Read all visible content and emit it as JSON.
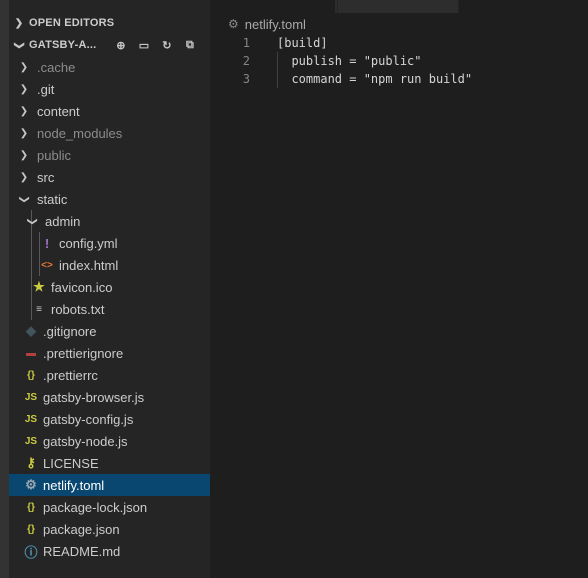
{
  "explorer": {
    "open_editors_label": "OPEN EDITORS",
    "root_label": "GATSBY-A...",
    "actions": [
      {
        "name": "new-file-icon",
        "glyph": "⊕"
      },
      {
        "name": "new-folder-icon",
        "glyph": "▭"
      },
      {
        "name": "refresh-icon",
        "glyph": "↻"
      },
      {
        "name": "collapse-all-icon",
        "glyph": "⧉"
      }
    ],
    "items": [
      {
        "label": ".cache",
        "kind": "folder",
        "depth": 1,
        "open": false,
        "dim": true
      },
      {
        "label": ".git",
        "kind": "folder",
        "depth": 1,
        "open": false,
        "dim": false
      },
      {
        "label": "content",
        "kind": "folder",
        "depth": 1,
        "open": false,
        "dim": false
      },
      {
        "label": "node_modules",
        "kind": "folder",
        "depth": 1,
        "open": false,
        "dim": true
      },
      {
        "label": "public",
        "kind": "folder",
        "depth": 1,
        "open": false,
        "dim": true
      },
      {
        "label": "src",
        "kind": "folder",
        "depth": 1,
        "open": false,
        "dim": false
      },
      {
        "label": "static",
        "kind": "folder",
        "depth": 1,
        "open": true,
        "dim": false
      },
      {
        "label": "admin",
        "kind": "folder",
        "depth": 2,
        "open": true,
        "dim": false
      },
      {
        "label": "config.yml",
        "kind": "file",
        "depth": 3,
        "icon": "yaml-icon",
        "glyph": "!",
        "color": "#a074c4"
      },
      {
        "label": "index.html",
        "kind": "file",
        "depth": 3,
        "icon": "html-icon",
        "glyph": "<>",
        "color": "#e37933"
      },
      {
        "label": "favicon.ico",
        "kind": "file",
        "depth": 2,
        "icon": "star-icon",
        "glyph": "★",
        "color": "#cbcb41"
      },
      {
        "label": "robots.txt",
        "kind": "file",
        "depth": 2,
        "icon": "text-file-icon",
        "glyph": "≡",
        "color": "#c5c5c5"
      },
      {
        "label": ".gitignore",
        "kind": "file",
        "depth": 1,
        "icon": "git-icon",
        "glyph": "◆",
        "color": "#41535b"
      },
      {
        "label": ".prettierignore",
        "kind": "file",
        "depth": 1,
        "icon": "prettier-ignore-icon",
        "glyph": "▬",
        "color": "#b0413e"
      },
      {
        "label": ".prettierrc",
        "kind": "file",
        "depth": 1,
        "icon": "json-icon",
        "glyph": "{}",
        "color": "#cbcb41"
      },
      {
        "label": "gatsby-browser.js",
        "kind": "file",
        "depth": 1,
        "icon": "js-icon",
        "glyph": "JS",
        "color": "#cbcb41"
      },
      {
        "label": "gatsby-config.js",
        "kind": "file",
        "depth": 1,
        "icon": "js-icon",
        "glyph": "JS",
        "color": "#cbcb41"
      },
      {
        "label": "gatsby-node.js",
        "kind": "file",
        "depth": 1,
        "icon": "js-icon",
        "glyph": "JS",
        "color": "#cbcb41"
      },
      {
        "label": "LICENSE",
        "kind": "file",
        "depth": 1,
        "icon": "license-icon",
        "glyph": "⚷",
        "color": "#cbcb41"
      },
      {
        "label": "netlify.toml",
        "kind": "file",
        "depth": 1,
        "icon": "gear-icon",
        "glyph": "⚙",
        "color": "#9aa5ad",
        "selected": true
      },
      {
        "label": "package-lock.json",
        "kind": "file",
        "depth": 1,
        "icon": "json-icon",
        "glyph": "{}",
        "color": "#cbcb41"
      },
      {
        "label": "package.json",
        "kind": "file",
        "depth": 1,
        "icon": "json-icon",
        "glyph": "{}",
        "color": "#cbcb41"
      },
      {
        "label": "README.md",
        "kind": "file",
        "depth": 1,
        "icon": "info-icon",
        "glyph": "ⓘ",
        "color": "#519aba"
      }
    ]
  },
  "editor": {
    "breadcrumb": "netlify.toml",
    "lines": [
      {
        "n": "1",
        "text": "[build]"
      },
      {
        "n": "2",
        "text": "  publish = \"public\""
      },
      {
        "n": "3",
        "text": "  command = \"npm run build\""
      }
    ]
  },
  "colors": {
    "selection": "#094771",
    "sidebar_bg": "#252526",
    "editor_bg": "#1e1e1e"
  }
}
